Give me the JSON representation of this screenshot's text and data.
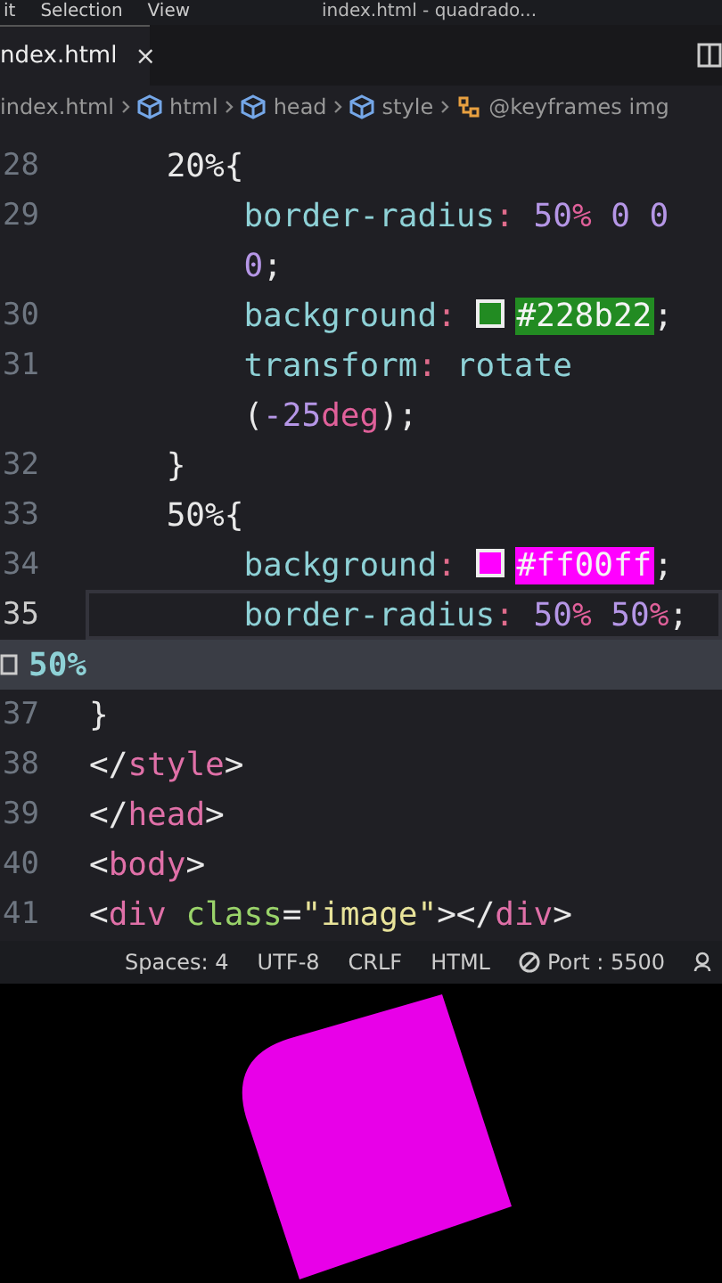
{
  "menu_bar": {
    "items": [
      "it",
      "Selection",
      "View"
    ],
    "title": "index.html - quadrado..."
  },
  "tabs": [
    {
      "label": "ndex.html",
      "selected": true,
      "close": "×"
    }
  ],
  "breadcrumbs": [
    {
      "label": "index.html",
      "kind": "file"
    },
    {
      "label": "html",
      "kind": "element"
    },
    {
      "label": "head",
      "kind": "element"
    },
    {
      "label": "style",
      "kind": "element"
    },
    {
      "label": "@keyframes img",
      "kind": "keyframes"
    }
  ],
  "editor": {
    "rows": [
      {
        "kind": "code",
        "number": "28",
        "current": false,
        "tokens": [
          {
            "kind": "text",
            "t": "    20%{",
            "color": "#e8e8e8"
          }
        ]
      },
      {
        "kind": "code",
        "number": "29",
        "current": false,
        "tokens": [
          {
            "kind": "text",
            "t": "        border-radius",
            "color": "#8ed1d6"
          },
          {
            "kind": "text",
            "t": ": ",
            "color": "#e06c8c"
          },
          {
            "kind": "text",
            "t": "50",
            "color": "#b596e6"
          },
          {
            "kind": "text",
            "t": "%",
            "color": "#e0609a"
          },
          {
            "kind": "text",
            "t": " 0 0",
            "color": "#b596e6"
          }
        ]
      },
      {
        "kind": "wrap",
        "tokens": [
          {
            "kind": "text",
            "t": "        0",
            "color": "#b596e6"
          },
          {
            "kind": "text",
            "t": ";",
            "color": "#e8e8e8"
          }
        ]
      },
      {
        "kind": "code",
        "number": "30",
        "current": false,
        "tokens": [
          {
            "kind": "text",
            "t": "        background",
            "color": "#8ed1d6"
          },
          {
            "kind": "text",
            "t": ": ",
            "color": "#e06c8c"
          },
          {
            "kind": "hex",
            "t": "#228b22",
            "color": "#228b22"
          },
          {
            "kind": "text",
            "t": ";",
            "color": "#e8e8e8"
          }
        ]
      },
      {
        "kind": "code",
        "number": "31",
        "current": false,
        "tokens": [
          {
            "kind": "text",
            "t": "        transform",
            "color": "#8ed1d6"
          },
          {
            "kind": "text",
            "t": ": ",
            "color": "#e06c8c"
          },
          {
            "kind": "text",
            "t": "rotate",
            "color": "#8ed1d6"
          }
        ]
      },
      {
        "kind": "wrap",
        "tokens": [
          {
            "kind": "text",
            "t": "        (",
            "color": "#e8e8e8"
          },
          {
            "kind": "text",
            "t": "-25",
            "color": "#b596e6"
          },
          {
            "kind": "text",
            "t": "deg",
            "color": "#e0609a"
          },
          {
            "kind": "text",
            "t": ");",
            "color": "#e8e8e8"
          }
        ]
      },
      {
        "kind": "code",
        "number": "32",
        "current": false,
        "tokens": [
          {
            "kind": "text",
            "t": "    }",
            "color": "#e8e8e8"
          }
        ]
      },
      {
        "kind": "code",
        "number": "33",
        "current": false,
        "tokens": [
          {
            "kind": "text",
            "t": "    50%{",
            "color": "#e8e8e8"
          }
        ]
      },
      {
        "kind": "code",
        "number": "34",
        "current": false,
        "tokens": [
          {
            "kind": "text",
            "t": "        background",
            "color": "#8ed1d6"
          },
          {
            "kind": "text",
            "t": ": ",
            "color": "#e06c8c"
          },
          {
            "kind": "hex",
            "t": "#ff00ff",
            "color": "#ff00ff"
          },
          {
            "kind": "text",
            "t": ";",
            "color": "#e8e8e8"
          }
        ]
      },
      {
        "kind": "code",
        "number": "35",
        "current": true,
        "tokens": [
          {
            "kind": "text",
            "t": "        border-radius",
            "color": "#8ed1d6"
          },
          {
            "kind": "text",
            "t": ": ",
            "color": "#e06c8c"
          },
          {
            "kind": "text",
            "t": "50",
            "color": "#b596e6"
          },
          {
            "kind": "text",
            "t": "%",
            "color": "#e0609a"
          },
          {
            "kind": "text",
            "t": " 50",
            "color": "#b596e6"
          },
          {
            "kind": "text",
            "t": "%",
            "color": "#e0609a"
          },
          {
            "kind": "text",
            "t": ";",
            "color": "#e8e8e8"
          }
        ]
      },
      {
        "kind": "suggestion",
        "text": "50%"
      },
      {
        "kind": "code",
        "number": "37",
        "current": false,
        "tokens": [
          {
            "kind": "text",
            "t": "}",
            "color": "#e8e8e8"
          }
        ]
      },
      {
        "kind": "code",
        "number": "38",
        "current": false,
        "tokens": [
          {
            "kind": "text",
            "t": "</",
            "color": "#e8e8e8"
          },
          {
            "kind": "text",
            "t": "style",
            "color": "#e070a8"
          },
          {
            "kind": "text",
            "t": ">",
            "color": "#e8e8e8"
          }
        ]
      },
      {
        "kind": "code",
        "number": "39",
        "current": false,
        "tokens": [
          {
            "kind": "text",
            "t": "</",
            "color": "#e8e8e8"
          },
          {
            "kind": "text",
            "t": "head",
            "color": "#e070a8"
          },
          {
            "kind": "text",
            "t": ">",
            "color": "#e8e8e8"
          }
        ]
      },
      {
        "kind": "code",
        "number": "40",
        "current": false,
        "tokens": [
          {
            "kind": "text",
            "t": "<",
            "color": "#e8e8e8"
          },
          {
            "kind": "text",
            "t": "body",
            "color": "#e070a8"
          },
          {
            "kind": "text",
            "t": ">",
            "color": "#e8e8e8"
          }
        ]
      },
      {
        "kind": "code",
        "number": "41",
        "current": false,
        "tokens": [
          {
            "kind": "text",
            "t": "<",
            "color": "#e8e8e8"
          },
          {
            "kind": "text",
            "t": "div ",
            "color": "#e070a8"
          },
          {
            "kind": "text",
            "t": "class",
            "color": "#9ad36a"
          },
          {
            "kind": "text",
            "t": "=",
            "color": "#e8e8e8"
          },
          {
            "kind": "text",
            "t": "\"image\"",
            "color": "#e8e39a"
          },
          {
            "kind": "text",
            "t": "></",
            "color": "#e8e8e8"
          },
          {
            "kind": "text",
            "t": "div",
            "color": "#e070a8"
          },
          {
            "kind": "text",
            "t": ">",
            "color": "#e8e8e8"
          }
        ]
      }
    ]
  },
  "status_bar": {
    "items": [
      "Spaces: 4",
      "UTF-8",
      "CRLF",
      "HTML"
    ],
    "port": "Port : 5500"
  }
}
